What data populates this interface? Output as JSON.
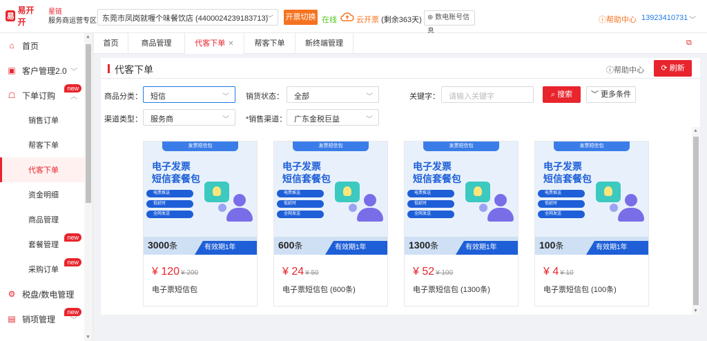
{
  "header": {
    "logo_mark": "易",
    "logo_text": "易开开",
    "org_line1": "星链",
    "org_line2": "服务商运营专区",
    "company": "东莞市凤岗就喱个味餐饮店 (4400024239183713)",
    "switch_label": "开票切换",
    "online": "在线",
    "cloud_label": "云开票",
    "cloud_remaining": "(剩余363天)",
    "digital_label": "数电账号信息",
    "help": "帮助中心",
    "phone": "13923410731"
  },
  "sidebar": {
    "items": [
      {
        "label": "首页",
        "icon": "home-icon",
        "glyph": "⌂"
      },
      {
        "label": "客户管理2.0",
        "icon": "customer-icon",
        "glyph": "▣"
      },
      {
        "label": "下单订购",
        "icon": "order-icon",
        "glyph": "☖",
        "badge": "new"
      },
      {
        "label": "销售订单"
      },
      {
        "label": "帮客下单"
      },
      {
        "label": "代客下单"
      },
      {
        "label": "资金明细"
      },
      {
        "label": "商品管理"
      },
      {
        "label": "套餐管理",
        "badge": "new"
      },
      {
        "label": "采购订单",
        "badge": "new"
      },
      {
        "label": "税盘/数电管理",
        "icon": "tax-icon",
        "glyph": "⚙"
      },
      {
        "label": "销项管理",
        "icon": "sales-icon",
        "glyph": "▤",
        "badge": "new"
      }
    ]
  },
  "tabs": [
    {
      "label": "首页"
    },
    {
      "label": "商品管理"
    },
    {
      "label": "代客下单"
    },
    {
      "label": "帮客下单"
    },
    {
      "label": "新终端管理"
    }
  ],
  "page": {
    "title": "代客下单",
    "help": "帮助中心",
    "refresh": "刷新"
  },
  "filters": {
    "category_label": "商品分类：",
    "category_value": "短信",
    "status_label": "销货状态：",
    "status_value": "全部",
    "keyword_label": "关键字：",
    "keyword_placeholder": "请输入关键字",
    "search": "搜索",
    "more": "更多条件",
    "channel_type_label": "渠道类型：",
    "channel_type_value": "服务商",
    "sales_channel_label": "*销售渠道：",
    "sales_channel_value": "广东金税巨益"
  },
  "products": [
    {
      "qty": "3000",
      "unit": "条",
      "price": "¥ 120",
      "orig": "¥ 200",
      "name": "电子票短信包"
    },
    {
      "qty": "600",
      "unit": "条",
      "price": "¥ 24",
      "orig": "¥ 50",
      "name": "电子票短信包 (600条)"
    },
    {
      "qty": "1300",
      "unit": "条",
      "price": "¥ 52",
      "orig": "¥ 100",
      "name": "电子票短信包 (1300条)"
    },
    {
      "qty": "100",
      "unit": "条",
      "price": "¥ 4",
      "orig": "¥ 10",
      "name": "电子票短信包 (100条)"
    }
  ],
  "card_art": {
    "ribbon": "发票短信包",
    "title1": "电子发票",
    "title2": "短信套餐包",
    "features": [
      "电票推送",
      "低延时",
      "全网发送"
    ],
    "valid": "有效期1年"
  },
  "colors": {
    "brand": "#e8242c",
    "accent": "#1e7ae6",
    "orange": "#f5731f"
  }
}
